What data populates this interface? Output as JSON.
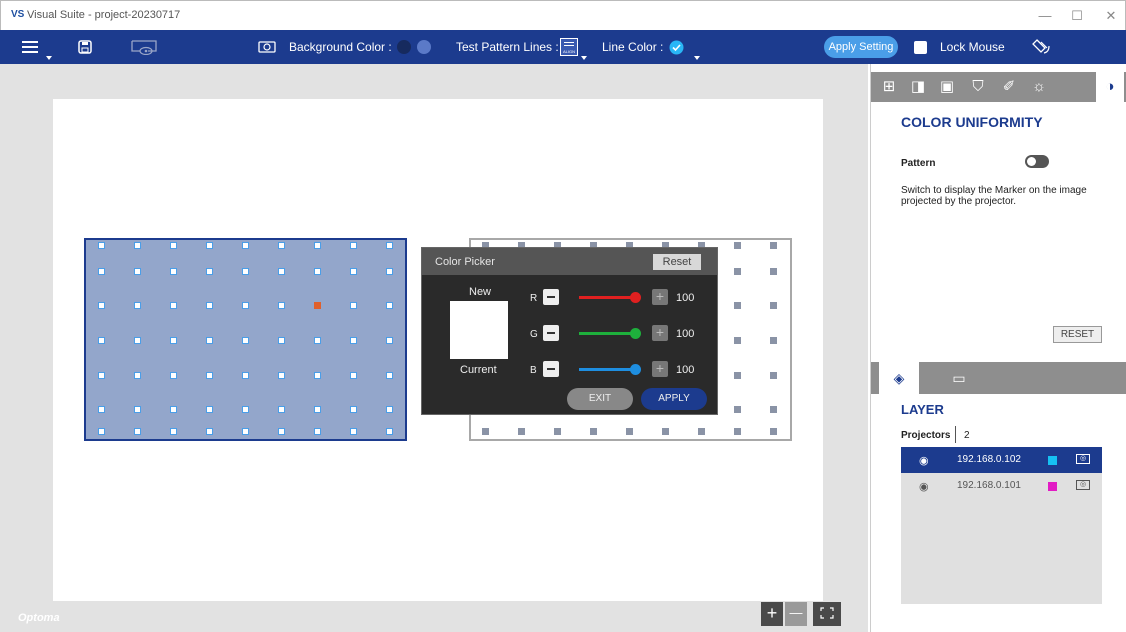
{
  "window": {
    "logo": "VS",
    "title": "Visual Suite - project-20230717",
    "minimize": "—",
    "maximize": "☐",
    "close": "✕"
  },
  "toolbar": {
    "background_color_label": "Background Color :",
    "test_pattern_label": "Test Pattern Lines :",
    "line_color_label": "Line Color :",
    "apply_setting_label": "Apply Setting",
    "lock_mouse_label": "Lock Mouse",
    "pattern_icon_text": "ALIGN",
    "colors": {
      "toolbar_bg": "#1c3b8e",
      "bg_color_1": "#162a5e",
      "bg_color_2": "#5b7ac8",
      "line_color": "#29b6f6"
    }
  },
  "canvas": {
    "projector1": {
      "fill": "#93a6cb",
      "selected_marker": "#e0602c"
    },
    "projector2": {
      "fill": "#ffffff"
    }
  },
  "color_picker": {
    "title": "Color Picker",
    "reset_label": "Reset",
    "new_label": "New",
    "current_label": "Current",
    "channels": [
      {
        "name": "R",
        "value": "100",
        "color": "#e02020"
      },
      {
        "name": "G",
        "value": "100",
        "color": "#1eb03c"
      },
      {
        "name": "B",
        "value": "100",
        "color": "#1e8ee0"
      }
    ],
    "exit_label": "EXIT",
    "apply_label": "APPLY"
  },
  "zoom": {
    "plus": "+",
    "minus": "—",
    "fit": "⛶"
  },
  "brand": "Optoma",
  "right_panel": {
    "title": "COLOR UNIFORMITY",
    "pattern_label": "Pattern",
    "pattern_description": "Switch to display the Marker on the image projected by the projector.",
    "reset_label": "RESET",
    "layer_title": "LAYER",
    "projectors_label": "Projectors",
    "projectors_count": "2",
    "projectors": [
      {
        "ip": "192.168.0.102",
        "color": "#16c1f2",
        "selected": true
      },
      {
        "ip": "192.168.0.101",
        "color": "#e21cc4",
        "selected": false
      }
    ]
  }
}
